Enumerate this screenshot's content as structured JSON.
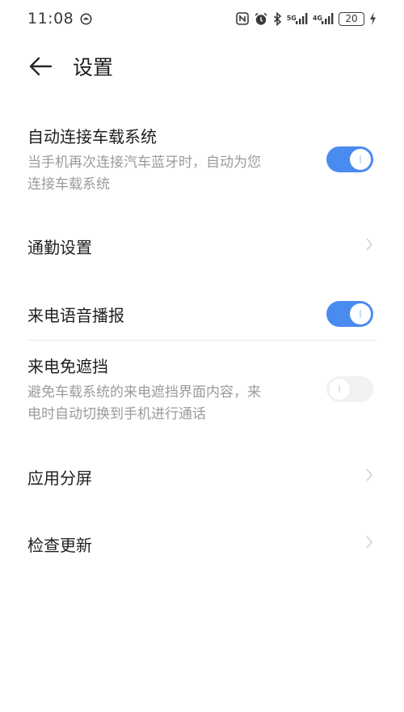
{
  "status_bar": {
    "time": "11:08",
    "net_5g": "5G",
    "net_4g": "4G",
    "battery_level": "20"
  },
  "header": {
    "title": "设置"
  },
  "settings": [
    {
      "title": "自动连接车载系统",
      "desc_line1": "当手机再次连接汽车蓝牙时，自动为您",
      "desc_line2": "连接车载系统",
      "control": "toggle",
      "enabled": true
    },
    {
      "title": "通勤设置",
      "control": "chevron"
    },
    {
      "title": "来电语音播报",
      "control": "toggle",
      "enabled": true
    },
    {
      "title": "来电免遮挡",
      "desc_line1": "避免车载系统的来电遮挡界面内容，来",
      "desc_line2": "电时自动切换到手机进行通话",
      "control": "toggle",
      "enabled": false
    },
    {
      "title": "应用分屏",
      "control": "chevron"
    },
    {
      "title": "检查更新",
      "control": "chevron"
    }
  ],
  "colors": {
    "accent": "#4a8bf0",
    "toggle_off": "#f2f2f2",
    "secondary_text": "#9b9b9b"
  }
}
